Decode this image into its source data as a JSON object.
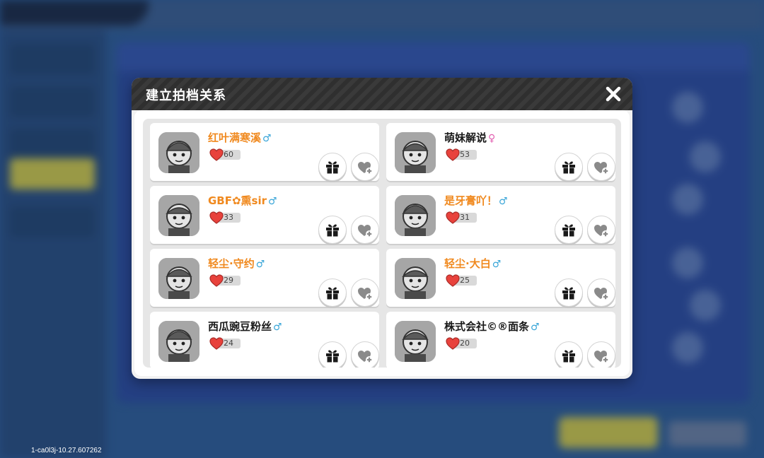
{
  "version": "1-ca0l3j-10.27.607262",
  "modal": {
    "title": "建立拍档关系",
    "close_icon": "close-icon"
  },
  "colors": {
    "name_orange": "#f0891e",
    "name_black": "#1a1a1a",
    "male": "#3aa6d8",
    "female": "#e25fb0",
    "heart_red": "#e8423c"
  },
  "friends": [
    {
      "name": "红叶满寒溪",
      "gender": "♂",
      "affinity": "60",
      "name_color": "orange"
    },
    {
      "name": "萌妹解说",
      "gender": "♀",
      "affinity": "53",
      "name_color": "black"
    },
    {
      "name": "GBF✿熏sir",
      "gender": "♂",
      "affinity": "33",
      "name_color": "orange"
    },
    {
      "name": "是牙膏吖！",
      "gender": "♂",
      "affinity": "31",
      "name_color": "orange"
    },
    {
      "name": "轻尘·守约",
      "gender": "♂",
      "affinity": "29",
      "name_color": "orange"
    },
    {
      "name": "轻尘·大白",
      "gender": "♂",
      "affinity": "25",
      "name_color": "orange"
    },
    {
      "name": "西瓜豌豆粉丝",
      "gender": "♂",
      "affinity": "24",
      "name_color": "black"
    },
    {
      "name": "株式会社©®面条",
      "gender": "♂",
      "affinity": "20",
      "name_color": "black"
    }
  ]
}
